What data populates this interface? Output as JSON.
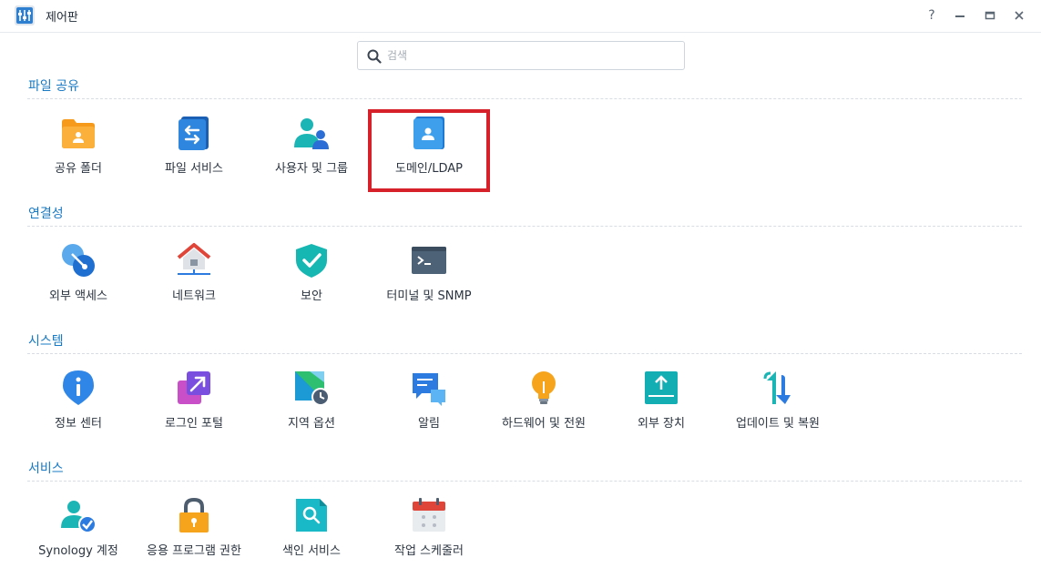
{
  "window": {
    "title": "제어판",
    "help_label": "?",
    "minimize_label": "–",
    "maximize_label": "▭",
    "close_label": "✕"
  },
  "search": {
    "placeholder": "검색",
    "value": ""
  },
  "sections": [
    {
      "title": "파일 공유",
      "items": [
        {
          "label": "공유 폴더",
          "icon": "shared-folder-icon"
        },
        {
          "label": "파일 서비스",
          "icon": "file-services-icon"
        },
        {
          "label": "사용자 및 그룹",
          "icon": "user-group-icon"
        },
        {
          "label": "도메인/LDAP",
          "icon": "domain-ldap-icon"
        }
      ]
    },
    {
      "title": "연결성",
      "items": [
        {
          "label": "외부 액세스",
          "icon": "external-access-icon"
        },
        {
          "label": "네트워크",
          "icon": "network-icon"
        },
        {
          "label": "보안",
          "icon": "security-shield-icon"
        },
        {
          "label": "터미널 및 SNMP",
          "icon": "terminal-icon"
        }
      ]
    },
    {
      "title": "시스템",
      "items": [
        {
          "label": "정보 센터",
          "icon": "info-center-icon"
        },
        {
          "label": "로그인 포털",
          "icon": "login-portal-icon"
        },
        {
          "label": "지역 옵션",
          "icon": "regional-options-icon"
        },
        {
          "label": "알림",
          "icon": "notification-icon"
        },
        {
          "label": "하드웨어 및 전원",
          "icon": "hardware-power-icon"
        },
        {
          "label": "외부 장치",
          "icon": "external-devices-icon"
        },
        {
          "label": "업데이트 및 복원",
          "icon": "update-restore-icon"
        }
      ]
    },
    {
      "title": "서비스",
      "items": [
        {
          "label": "Synology 계정",
          "icon": "synology-account-icon"
        },
        {
          "label": "응용 프로그램 권한",
          "icon": "application-privileges-icon"
        },
        {
          "label": "색인 서비스",
          "icon": "indexing-service-icon"
        },
        {
          "label": "작업 스케줄러",
          "icon": "task-scheduler-icon"
        }
      ]
    }
  ],
  "highlighted_item": "도메인/LDAP",
  "colors": {
    "section_title": "#1779c4",
    "highlight_border": "#d6202a"
  }
}
